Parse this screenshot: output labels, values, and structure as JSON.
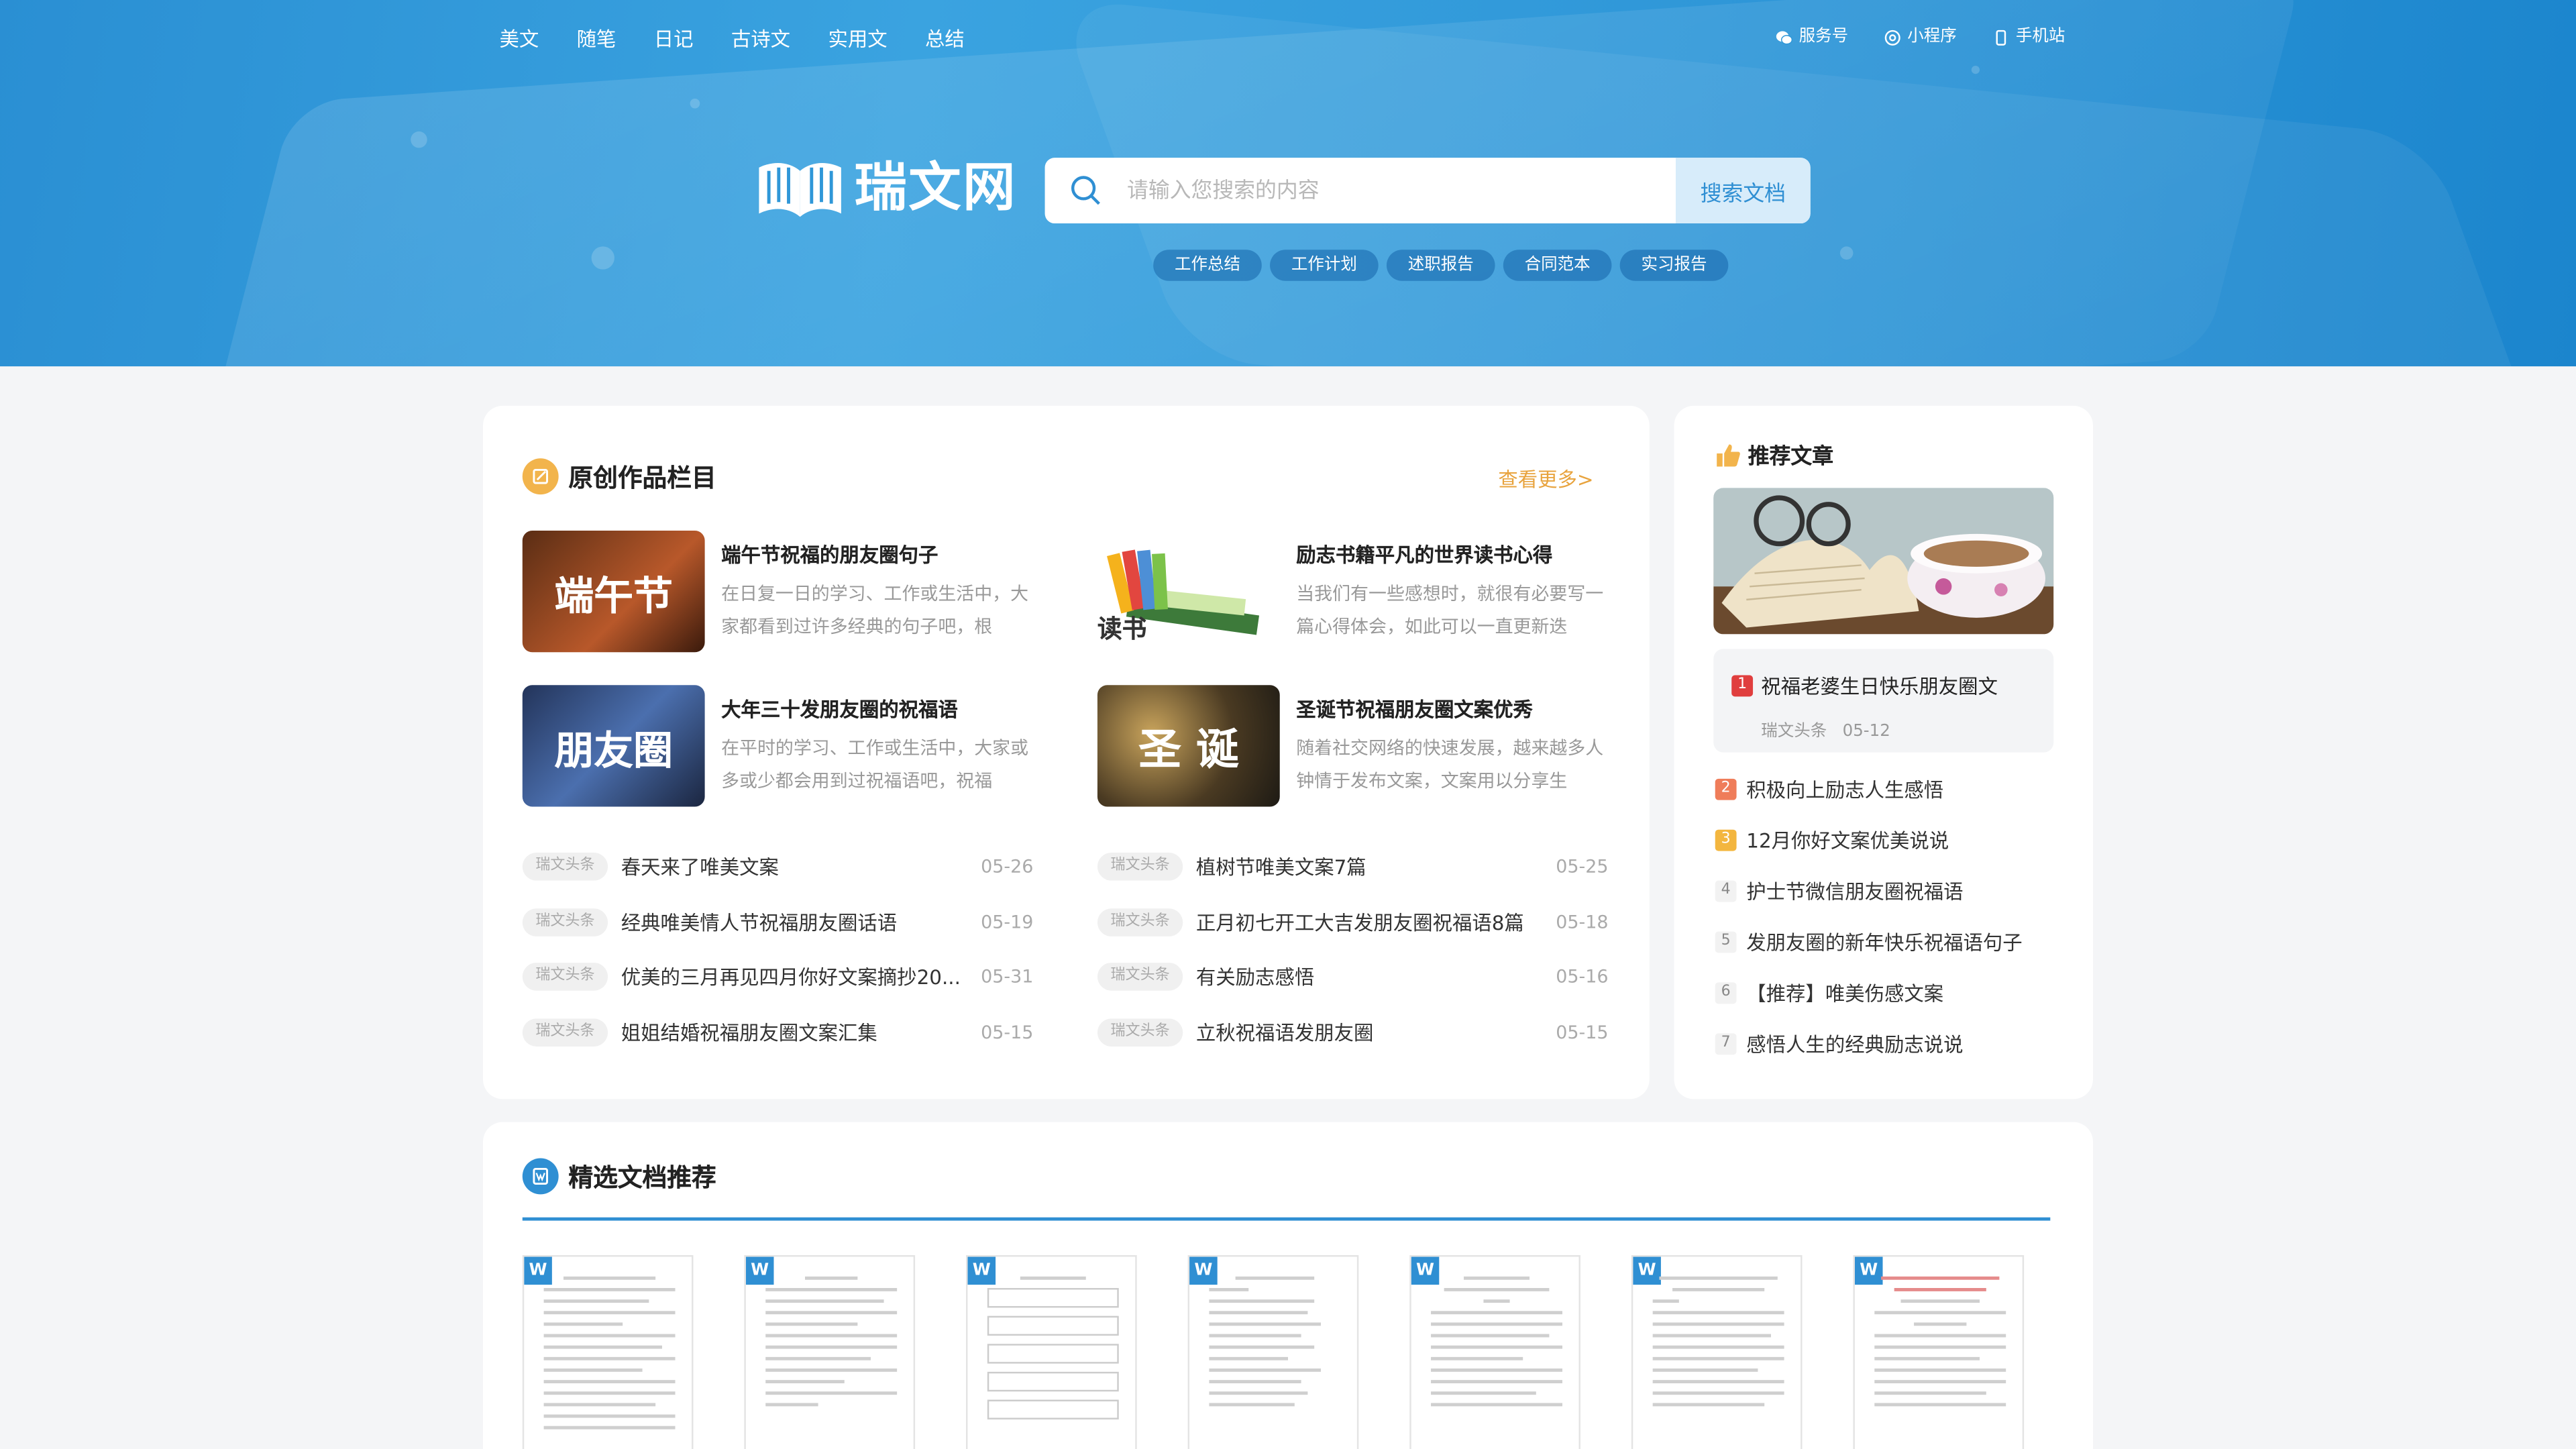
{
  "nav": {
    "items": [
      "美文",
      "随笔",
      "日记",
      "古诗文",
      "实用文",
      "总结"
    ],
    "right": [
      {
        "label": "服务号",
        "icon": "wechat-icon"
      },
      {
        "label": "小程序",
        "icon": "mini-program-icon"
      },
      {
        "label": "手机站",
        "icon": "mobile-icon"
      }
    ]
  },
  "logo": {
    "text": "瑞文网"
  },
  "search": {
    "placeholder": "请输入您搜索的内容",
    "button": "搜索文档"
  },
  "hot_tags": [
    "工作总结",
    "工作计划",
    "述职报告",
    "合同范本",
    "实习报告"
  ],
  "original": {
    "title": "原创作品栏目",
    "more": "查看更多>",
    "cards": [
      {
        "thumb_text": "端午节",
        "title": "端午节祝福的朋友圈句子",
        "desc": "在日复一日的学习、工作或生活中，大家都看到过许多经典的句子吧，根"
      },
      {
        "thumb_text": "读书",
        "title": "励志书籍平凡的世界读书心得",
        "desc": "当我们有一些感想时，就很有必要写一篇心得体会，如此可以一直更新迭"
      },
      {
        "thumb_text": "朋友圈",
        "title": "大年三十发朋友圈的祝福语",
        "desc": "在平时的学习、工作或生活中，大家或多或少都会用到过祝福语吧，祝福"
      },
      {
        "thumb_text": "圣 诞",
        "title": "圣诞节祝福朋友圈文案优秀",
        "desc": "随着社交网络的快速发展，越来越多人钟情于发布文案，文案用以分享生"
      }
    ],
    "list_left": [
      {
        "badge": "瑞文头条",
        "title": "春天来了唯美文案",
        "date": "05-26"
      },
      {
        "badge": "瑞文头条",
        "title": "经典唯美情人节祝福朋友圈话语",
        "date": "05-19"
      },
      {
        "badge": "瑞文头条",
        "title": "优美的三月再见四月你好文案摘抄20...",
        "date": "05-31"
      },
      {
        "badge": "瑞文头条",
        "title": "姐姐结婚祝福朋友圈文案汇集",
        "date": "05-15"
      }
    ],
    "list_right": [
      {
        "badge": "瑞文头条",
        "title": "植树节唯美文案7篇",
        "date": "05-25"
      },
      {
        "badge": "瑞文头条",
        "title": "正月初七开工大吉发朋友圈祝福语8篇",
        "date": "05-18"
      },
      {
        "badge": "瑞文头条",
        "title": "有关励志感悟",
        "date": "05-16"
      },
      {
        "badge": "瑞文头条",
        "title": "立秋祝福语发朋友圈",
        "date": "05-15"
      }
    ]
  },
  "recommend": {
    "title": "推荐文章",
    "first": {
      "num": "1",
      "title": "祝福老婆生日快乐朋友圈文",
      "source": "瑞文头条",
      "date": "05-12"
    },
    "items": [
      {
        "num": "2",
        "title": "积极向上励志人生感悟",
        "color": "#ef7d5a"
      },
      {
        "num": "3",
        "title": "12月你好文案优美说说",
        "color": "#f3b63f"
      },
      {
        "num": "4",
        "title": "护士节微信朋友圈祝福语"
      },
      {
        "num": "5",
        "title": "发朋友圈的新年快乐祝福语句子"
      },
      {
        "num": "6",
        "title": "【推荐】唯美伤感文案"
      },
      {
        "num": "7",
        "title": "感悟人生的经典励志说说"
      }
    ]
  },
  "featured": {
    "title": "精选文档推荐",
    "docs": [
      "W",
      "W",
      "W",
      "W",
      "W",
      "W",
      "W"
    ]
  },
  "colors": {
    "accent": "#2f8fd3",
    "more": "#e8a33d",
    "rank1": "#e03e3e"
  }
}
